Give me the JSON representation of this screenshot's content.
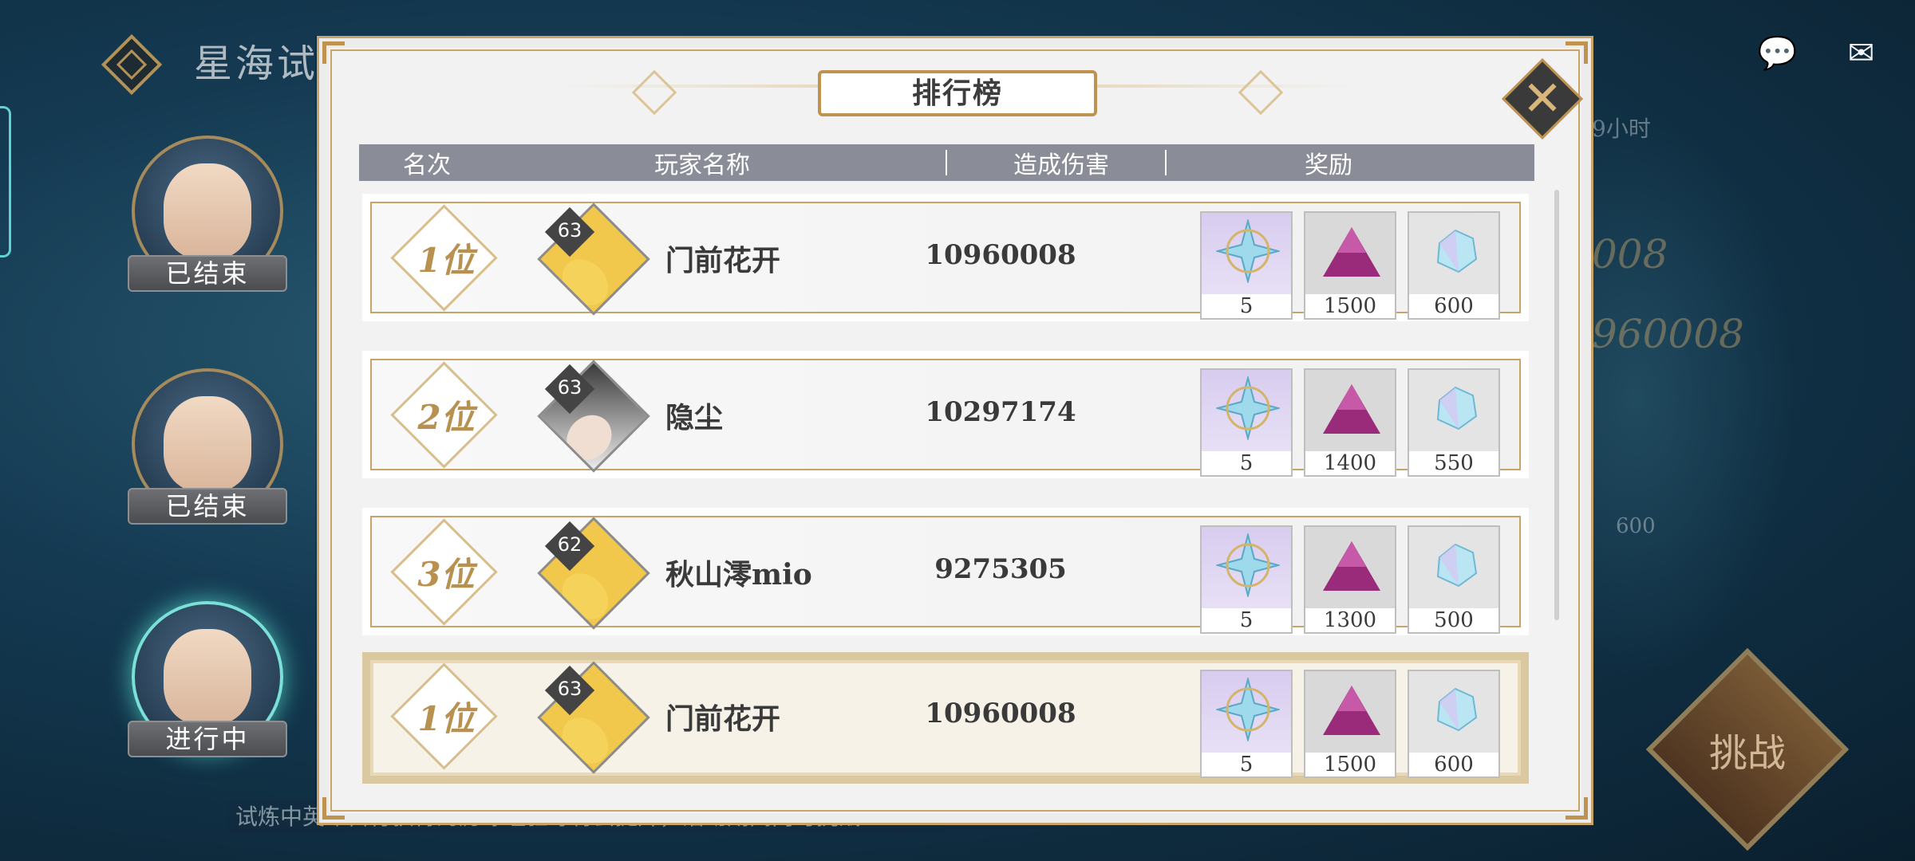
{
  "page": {
    "title": "星海试炼",
    "notice": "试炼中英雄自行获得的历练经验等将会提升，活动期间内可挑战"
  },
  "heroes": [
    {
      "status": "已结束"
    },
    {
      "status": "已结束"
    },
    {
      "status": "进行中"
    }
  ],
  "background": {
    "damage_a": "008",
    "damage_b": "960008",
    "reward_count": "600",
    "time_left": "9小时",
    "challenge_label": "挑战"
  },
  "modal": {
    "title": "排行榜",
    "columns": {
      "rank": "名次",
      "player": "玩家名称",
      "damage": "造成伤害",
      "reward": "奖励"
    },
    "rows": [
      {
        "rank": "1位",
        "level": "63",
        "name": "门前花开",
        "damage": "10960008",
        "rewards": [
          "5",
          "1500",
          "600"
        ]
      },
      {
        "rank": "2位",
        "level": "63",
        "name": "隐尘",
        "damage": "10297174",
        "rewards": [
          "5",
          "1400",
          "550"
        ]
      },
      {
        "rank": "3位",
        "level": "62",
        "name": "秋山澪mio",
        "damage": "9275305",
        "rewards": [
          "5",
          "1300",
          "500"
        ]
      }
    ],
    "my_row": {
      "rank": "1位",
      "level": "63",
      "name": "门前花开",
      "damage": "10960008",
      "rewards": [
        "5",
        "1500",
        "600"
      ]
    }
  },
  "icons": {
    "logo": "diamond-logo-icon",
    "chat": "chat-bubble-icon",
    "mail": "mail-icon",
    "close": "close-icon",
    "reward1": "star-compass-icon",
    "reward2": "purple-dust-icon",
    "reward3": "crystal-icon"
  }
}
